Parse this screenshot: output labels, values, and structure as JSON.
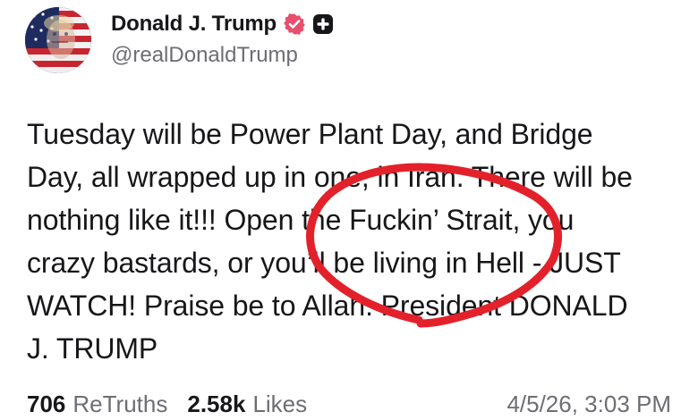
{
  "post": {
    "author": {
      "display_name": "Donald J. Trump",
      "handle": "@realDonaldTrump",
      "avatar_icon": "flag-portrait-avatar",
      "verified_icon": "verified-badge-icon",
      "verified_color": "#e74f6d",
      "plus_icon": "plus-badge-icon"
    },
    "body": "Tuesday will be Power Plant Day, and Bridge\nDay, all wrapped up in one, in Iran. There will be\nnothing like it!!! Open the Fuckin’ Strait, you\ncrazy bastards, or you’ll be living in Hell - JUST\nWATCH! Praise be to Allah. President DONALD\nJ. TRUMP",
    "stats": {
      "retruths_count": "706",
      "retruths_label": "ReTruths",
      "likes_count": "2.58k",
      "likes_label": "Likes"
    },
    "timestamp": "4/5/26, 3:03 PM"
  },
  "annotation": {
    "color": "#e3212b"
  }
}
